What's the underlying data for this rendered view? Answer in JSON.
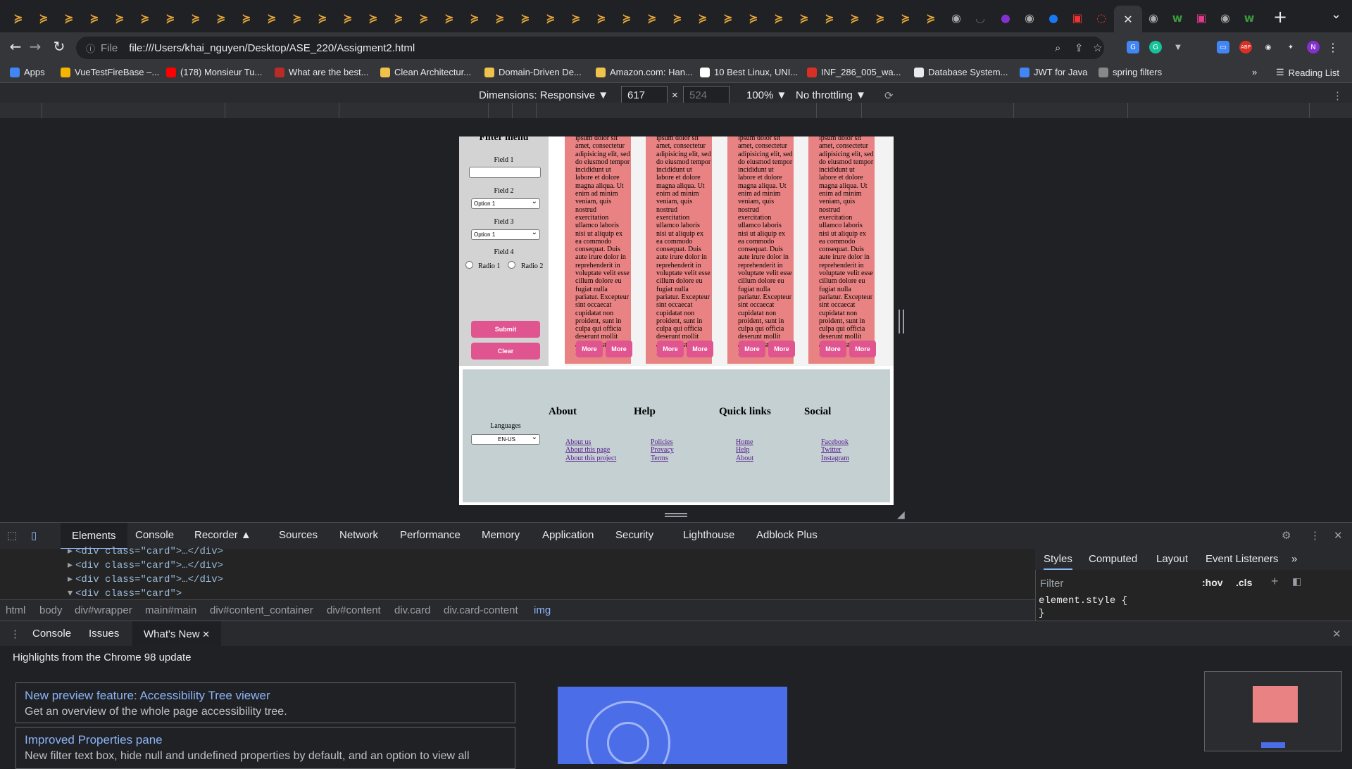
{
  "browser": {
    "url": "file:///Users/khai_nguyen/Desktop/ASE_220/Assigment2.html",
    "scheme_label": "File",
    "profile_initial": "N",
    "new_tab_symbol": "+",
    "close_tab_symbol": "✕"
  },
  "bookmarks": [
    {
      "label": "Apps",
      "color": "#4285f4"
    },
    {
      "label": "VueTestFireBase –...",
      "color": "#f4b400"
    },
    {
      "label": "(178) Monsieur Tu...",
      "color": "#ff0000"
    },
    {
      "label": "What are the best...",
      "color": "#b92b27"
    },
    {
      "label": "Clean Architectur...",
      "color": "#f0c14b"
    },
    {
      "label": "Domain-Driven De...",
      "color": "#f0c14b"
    },
    {
      "label": "Amazon.com: Han...",
      "color": "#f0c14b"
    },
    {
      "label": "10 Best Linux, UNI...",
      "color": "#ffffff"
    },
    {
      "label": "INF_286_005_wa...",
      "color": "#d93025"
    },
    {
      "label": "Database System...",
      "color": "#e8eaed"
    },
    {
      "label": "JWT for Java",
      "color": "#4285f4"
    },
    {
      "label": "spring filters",
      "color": "#888888"
    }
  ],
  "bookmarks_more": "»",
  "reading_list": "Reading List",
  "device_toolbar": {
    "dimensions_label": "Dimensions: Responsive ▼",
    "width": "617",
    "height": "524",
    "times": "×",
    "zoom": "100% ▼",
    "throttling": "No throttling ▼"
  },
  "page": {
    "filter_title": "Filter menu",
    "field1_label": "Field 1",
    "field2_label": "Field 2",
    "field2_value": "Option 1",
    "field3_label": "Field 3",
    "field3_value": "Option 1",
    "field4_label": "Field 4",
    "radio1_label": "Radio 1",
    "radio2_label": "Radio 2",
    "submit_label": "Submit",
    "clear_label": "Clear",
    "card_text": "ipsum dolor sit amet, consectetur adipisicing elit, sed do eiusmod tempor incididunt ut labore et dolore magna aliqua. Ut enim ad minim veniam, quis nostrud exercitation ullamco laboris nisi ut aliquip ex ea commodo consequat. Duis aute irure dolor in reprehenderit in voluptate velit esse cillum dolore eu fugiat nulla pariatur. Excepteur sint occaecat cupidatat non proident, sunt in culpa qui officia deserunt mollit anim id est laborum.",
    "more_label": "More",
    "languages_label": "Languages",
    "language_value": "EN-US",
    "footer": {
      "about": {
        "title": "About",
        "links": [
          "About us",
          "About this page",
          "About this project"
        ]
      },
      "help": {
        "title": "Help",
        "links": [
          "Policies",
          "Provacy",
          "Terms"
        ]
      },
      "quick": {
        "title": "Quick links",
        "links": [
          "Home",
          "Help",
          "About"
        ]
      },
      "social": {
        "title": "Social",
        "links": [
          "Facebook",
          "Twitter",
          "Instagram"
        ]
      }
    }
  },
  "devtools": {
    "tabs": [
      "Elements",
      "Console",
      "Recorder ▲",
      "Sources",
      "Network",
      "Performance",
      "Memory",
      "Application",
      "Security",
      "Lighthouse",
      "Adblock Plus"
    ],
    "dom_rows": [
      "<div class=\"card\">…</div>",
      "<div class=\"card\">…</div>",
      "<div class=\"card\">…</div>",
      "<div class=\"card\">"
    ],
    "breadcrumbs": [
      "html",
      "body",
      "div#wrapper",
      "main#main",
      "div#content_container",
      "div#content",
      "div.card",
      "div.card-content",
      "img"
    ],
    "styles_tabs": [
      "Styles",
      "Computed",
      "Layout",
      "Event Listeners",
      "»"
    ],
    "filter_placeholder": "Filter",
    "hov": ":hov",
    "cls": ".cls",
    "element_style": "element.style {",
    "element_style_close": "}",
    "drawer_tabs": [
      "Console",
      "Issues",
      "What's New"
    ],
    "whats_new_heading": "Highlights from the Chrome 98 update",
    "items": [
      {
        "title": "New preview feature: Accessibility Tree viewer",
        "desc": "Get an overview of the whole page accessibility tree."
      },
      {
        "title": "Improved Properties pane",
        "desc": "New filter text box, hide null and undefined properties by default, and an option to view all"
      }
    ]
  },
  "colors": {
    "accent": "#8ab4f8",
    "card": "#e98383",
    "button": "#e0558f",
    "footer": "#c5d0d3"
  }
}
